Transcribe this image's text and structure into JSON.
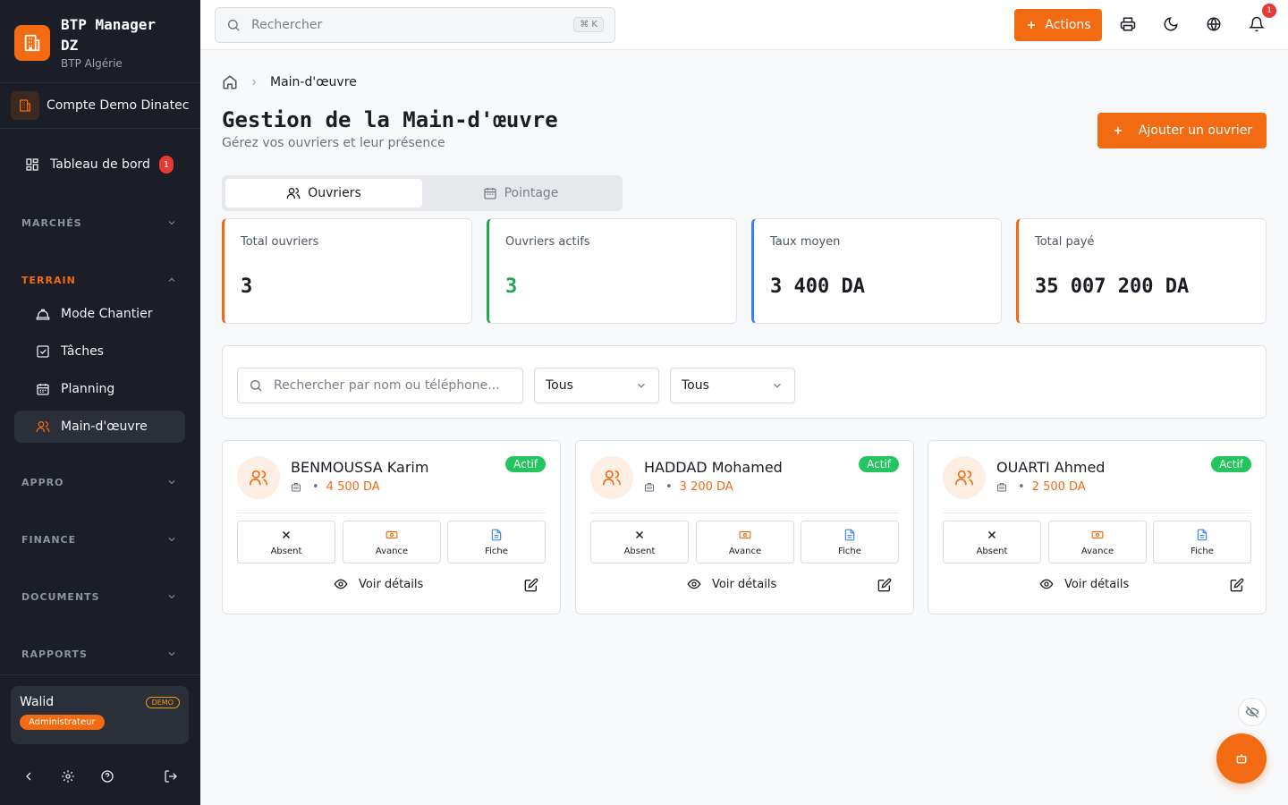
{
  "brand": {
    "title": "BTP Manager DZ",
    "subtitle": "BTP Algérie"
  },
  "account": {
    "name": "Compte Demo Dinatec"
  },
  "sidebar": {
    "dashboard": {
      "label": "Tableau de bord",
      "badge": "1"
    },
    "sections": [
      {
        "label": "MARCHÉS"
      },
      {
        "label": "TERRAIN"
      },
      {
        "label": "APPRO"
      },
      {
        "label": "FINANCE"
      },
      {
        "label": "DOCUMENTS"
      },
      {
        "label": "RAPPORTS"
      }
    ],
    "terrain_items": [
      {
        "label": "Mode Chantier",
        "icon": "hard-hat-icon"
      },
      {
        "label": "Tâches",
        "icon": "checkbox-icon"
      },
      {
        "label": "Planning",
        "icon": "calendar-icon"
      },
      {
        "label": "Main-d'œuvre",
        "icon": "users-icon",
        "active": true
      }
    ]
  },
  "user": {
    "name": "Walid",
    "demo": "DEMO",
    "role": "Administrateur"
  },
  "header": {
    "search_placeholder": "Rechercher",
    "shortcut": "⌘ K",
    "actions_label": "Actions",
    "notif_count": "1"
  },
  "breadcrumb": {
    "current": "Main-d'œuvre"
  },
  "page": {
    "title": "Gestion de la Main-d'œuvre",
    "subtitle": "Gérez vos ouvriers et leur présence",
    "add_button": "Ajouter un ouvrier"
  },
  "tabs": [
    {
      "label": "Ouvriers",
      "active": true
    },
    {
      "label": "Pointage",
      "active": false
    }
  ],
  "stats": [
    {
      "label": "Total ouvriers",
      "value": "3",
      "accent": "#f26b12",
      "value_color": "#1a1d23"
    },
    {
      "label": "Ouvriers actifs",
      "value": "3",
      "accent": "#22a653",
      "value_color": "#22a653"
    },
    {
      "label": "Taux moyen",
      "value": "3 400 DA",
      "accent": "#3b82f6",
      "value_color": "#1a1d23"
    },
    {
      "label": "Total payé",
      "value": "35 007 200 DA",
      "accent": "#f26b12",
      "value_color": "#1a1d23"
    }
  ],
  "filters": {
    "search_placeholder": "Rechercher par nom ou téléphone...",
    "select1": "Tous",
    "select2": "Tous"
  },
  "workers": [
    {
      "name": "BENMOUSSA Karim",
      "rate": "4 500 DA",
      "status": "Actif"
    },
    {
      "name": "HADDAD Mohamed",
      "rate": "3 200 DA",
      "status": "Actif"
    },
    {
      "name": "OUARTI Ahmed",
      "rate": "2 500 DA",
      "status": "Actif"
    }
  ],
  "card_actions": {
    "absent": "Absent",
    "avance": "Avance",
    "fiche": "Fiche",
    "details": "Voir détails"
  },
  "colors": {
    "accent": "#f26b12",
    "sidebar_bg": "#1b1e27",
    "success": "#22c55e",
    "danger": "#e53935"
  }
}
